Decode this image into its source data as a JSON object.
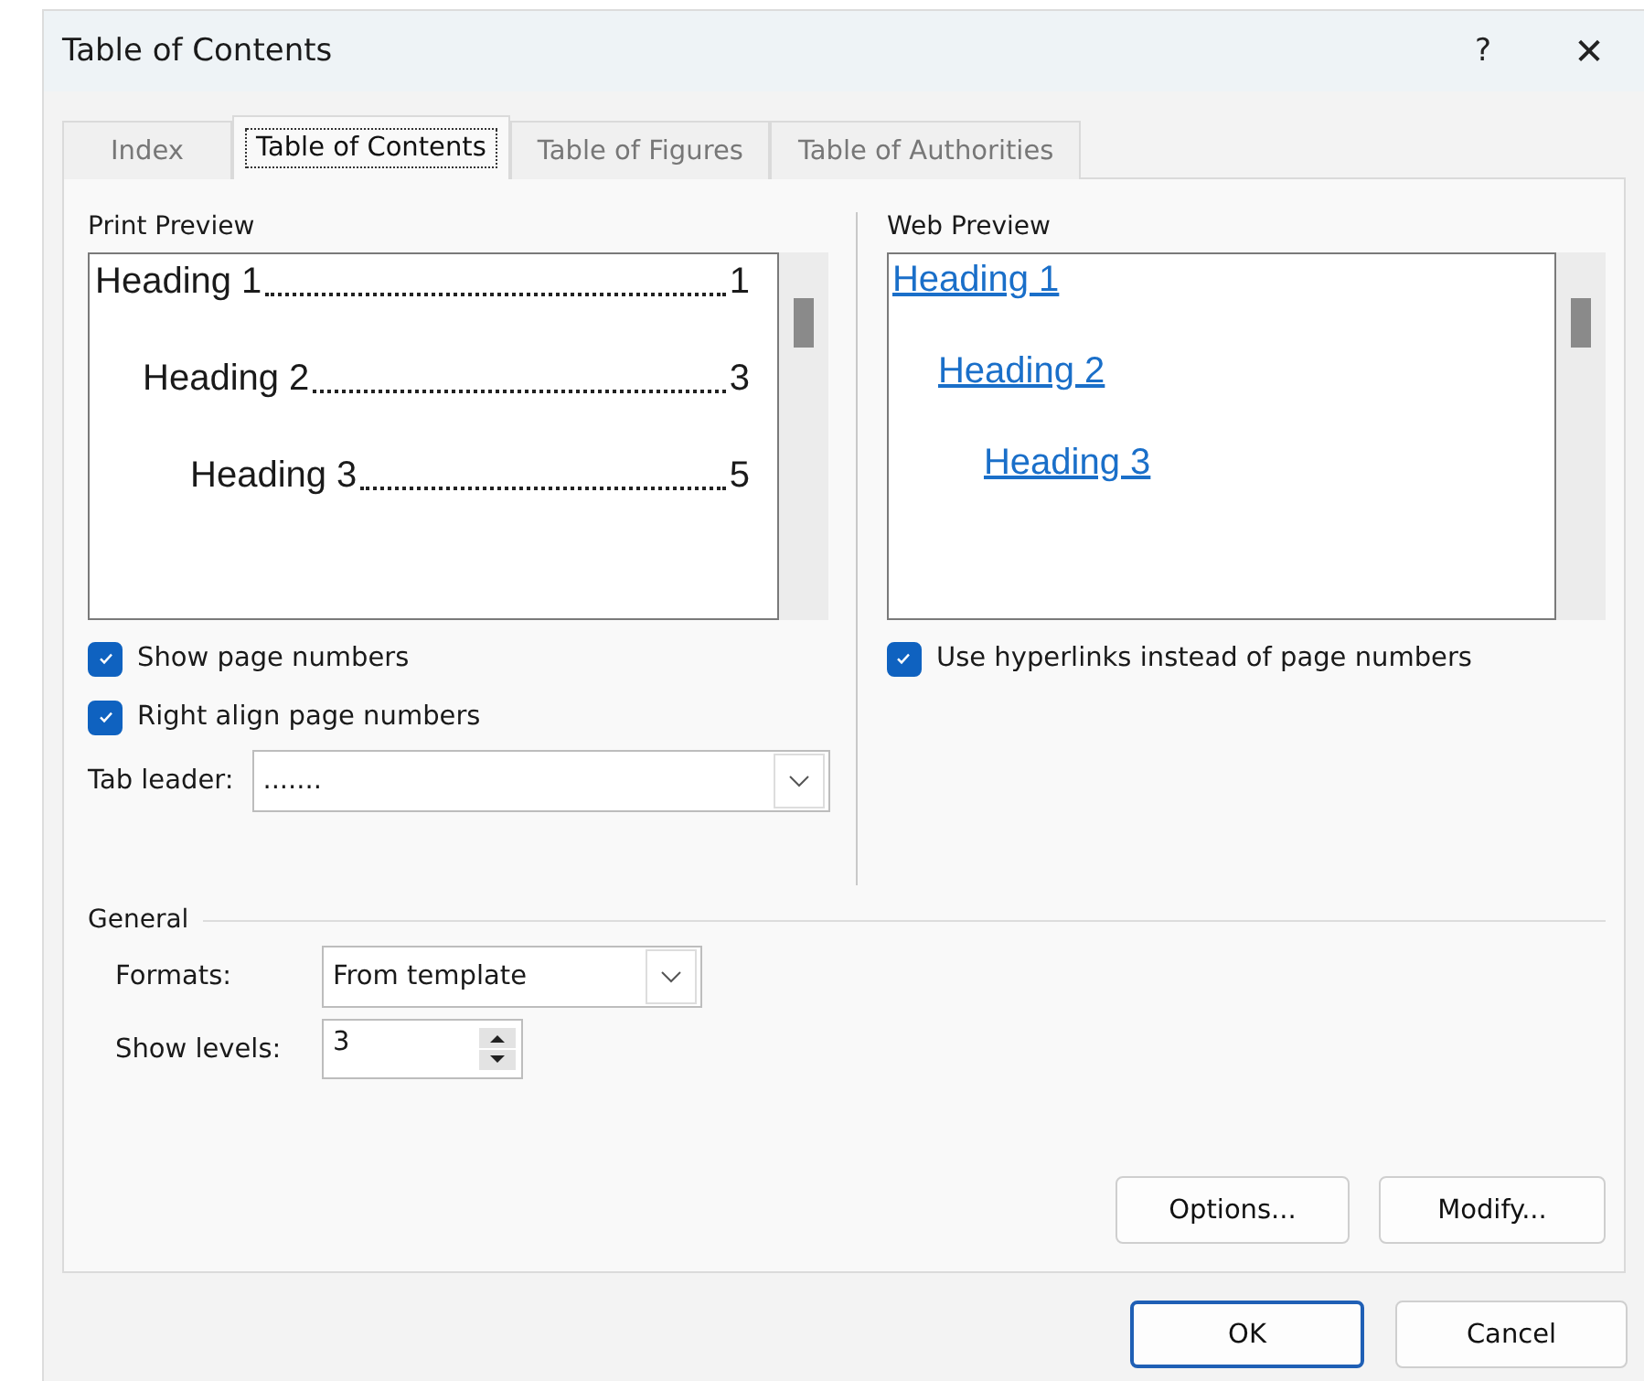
{
  "window": {
    "title": "Table of Contents",
    "help": "?",
    "close": "✕"
  },
  "tabs": [
    {
      "label": "Index",
      "selected": false
    },
    {
      "label": "Table of Contents",
      "selected": true
    },
    {
      "label": "Table of Figures",
      "selected": false
    },
    {
      "label": "Table of Authorities",
      "selected": false
    }
  ],
  "print_preview": {
    "label": "Print Preview",
    "entries": [
      {
        "text": "Heading 1",
        "page": "1",
        "children": [
          {
            "text": "Heading 2",
            "page": "3",
            "children": [
              {
                "text": "Heading 3",
                "page": "5"
              }
            ]
          }
        ]
      }
    ]
  },
  "print_options": [
    {
      "label": "Show page numbers",
      "checked": true
    },
    {
      "label": "Right align page numbers",
      "checked": true
    }
  ],
  "tab_leader": {
    "label": "Tab leader:",
    "value": "......."
  },
  "web_preview": {
    "label": "Web Preview",
    "entries": [
      {
        "text": "Heading 1",
        "children": [
          {
            "text": "Heading 2",
            "children": [
              {
                "text": "Heading 3"
              }
            ]
          }
        ]
      }
    ]
  },
  "web_options": [
    {
      "label": "Use hyperlinks instead of page numbers",
      "checked": true
    }
  ],
  "general": {
    "title": "General",
    "formats_label": "Formats:",
    "formats_value": "From template",
    "levels_label": "Show levels:",
    "levels_value": "3"
  },
  "panel_buttons": [
    "Options...",
    "Modify..."
  ],
  "buttons": [
    {
      "label": "OK",
      "default": true
    },
    {
      "label": "Cancel",
      "default": false
    }
  ]
}
